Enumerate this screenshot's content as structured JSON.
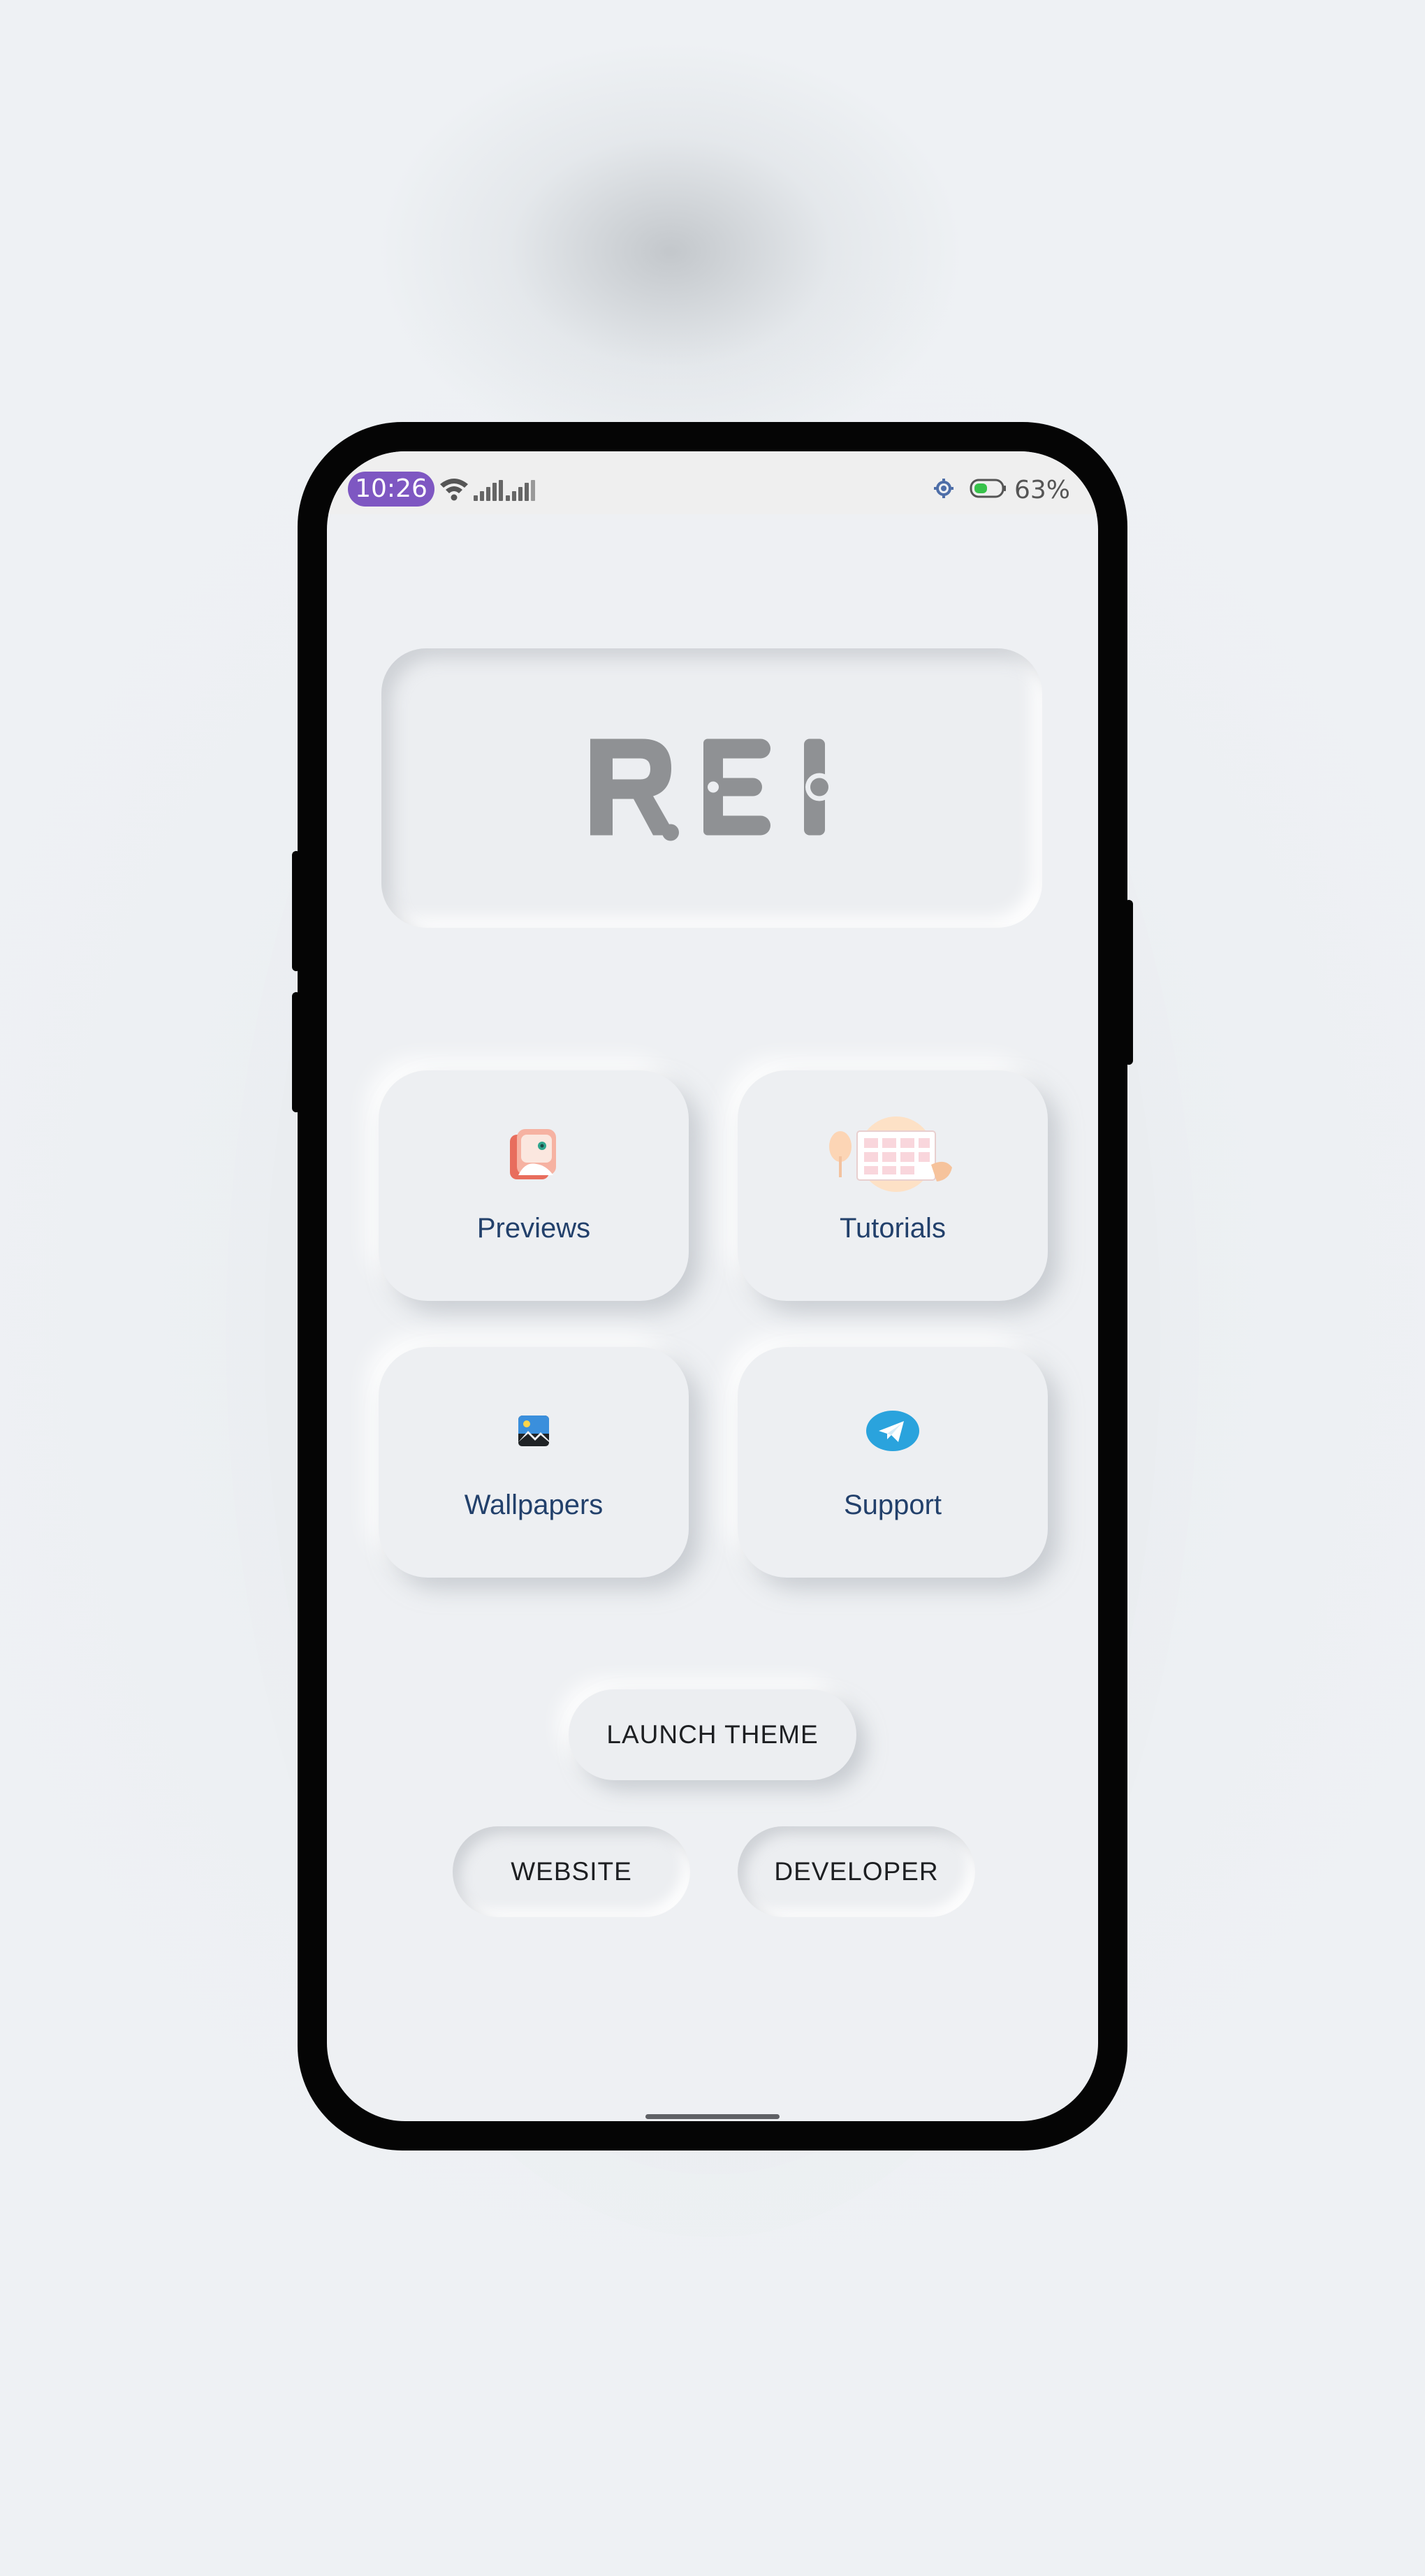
{
  "status_bar": {
    "time": "10:26",
    "battery_percent": "63%",
    "icons": [
      "wifi-icon",
      "signal-icon",
      "signal-icon",
      "settings-gear-icon",
      "battery-icon"
    ]
  },
  "logo": {
    "text": "REI",
    "color": "#8f9194"
  },
  "cards": [
    {
      "label": "Previews",
      "icon": "previews-icon"
    },
    {
      "label": "Tutorials",
      "icon": "tutorials-icon"
    },
    {
      "label": "Wallpapers",
      "icon": "wallpapers-icon"
    },
    {
      "label": "Support",
      "icon": "telegram-icon"
    }
  ],
  "buttons": {
    "launch_theme": "LAUNCH THEME",
    "website": "WEBSITE",
    "developer": "DEVELOPER"
  },
  "colors": {
    "time_pill": "#7e57c2",
    "card_label": "#22406b",
    "screen_bg": "#eef0f3",
    "support_blue": "#2aa3dd"
  }
}
